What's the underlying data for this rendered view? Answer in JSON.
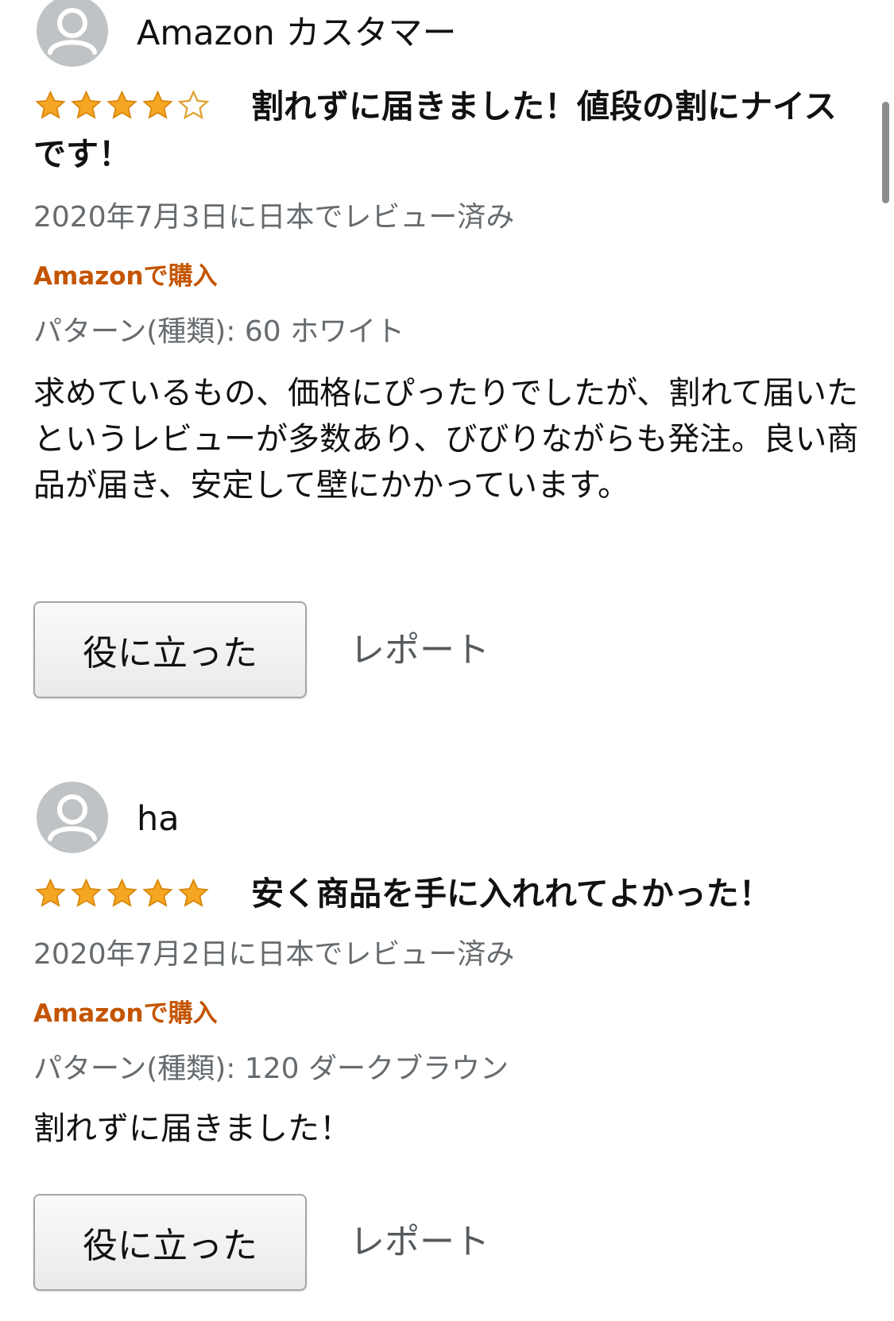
{
  "reviews": [
    {
      "author": "Amazon カスタマー",
      "avatar_icon": "default-user-avatar-icon",
      "rating": 4,
      "rating_max": 5,
      "title": "割れずに届きました！値段の割にナイスです！",
      "date": "2020年7月3日に日本でレビュー済み",
      "verified": "Amazonで購入",
      "variant": "パターン(種類): 60 ホワイト",
      "body": "求めているもの、価格にぴったりでしたが、割れて届いたというレビューが多数あり、びびりながらも発注。良い商品が届き、安定して壁にかかっています。",
      "helpful_label": "役に立った",
      "report_label": "レポート"
    },
    {
      "author": "ha",
      "avatar_icon": "default-user-avatar-icon",
      "rating": 5,
      "rating_max": 5,
      "title": "安く商品を手に入れれてよかった！",
      "date": "2020年7月2日に日本でレビュー済み",
      "verified": "Amazonで購入",
      "variant": "パターン(種類): 120 ダークブラウン",
      "body": "割れずに届きました！",
      "helpful_label": "役に立った",
      "report_label": "レポート"
    }
  ],
  "colors": {
    "star_filled": "#f5a623",
    "star_stroke": "#d9860b",
    "star_empty_stroke": "#e0a030",
    "verified": "#c45500",
    "meta_text": "#666b6f",
    "avatar_bg": "#bfc3c5"
  }
}
